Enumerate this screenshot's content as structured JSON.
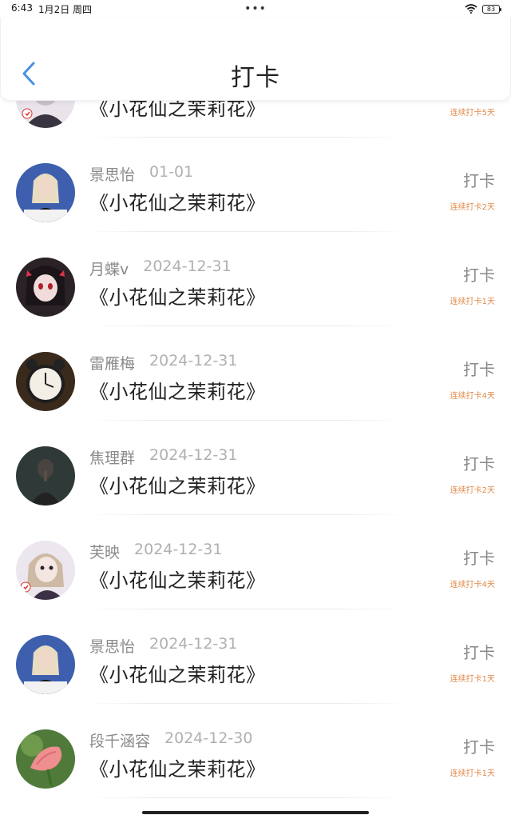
{
  "status_bar": {
    "time": "6:43",
    "date": "1月2日 周四",
    "dots": "•••",
    "battery": "83"
  },
  "header": {
    "title": "打卡"
  },
  "colors": {
    "accent": "#4a90e2",
    "streak": "#e08a4a"
  },
  "records": [
    {
      "name": "",
      "date": "",
      "book": "《小花仙之茉莉花》",
      "action": "",
      "streak": "连续打卡5天",
      "avatar": "anime-avatar"
    },
    {
      "name": "景思怡",
      "date": "01-01",
      "book": "《小花仙之茉莉花》",
      "action": "打卡",
      "streak": "连续打卡2天",
      "avatar": "photo-avatar-girl"
    },
    {
      "name": "月蝶v",
      "date": "2024-12-31",
      "book": "《小花仙之茉莉花》",
      "action": "打卡",
      "streak": "连续打卡1天",
      "avatar": "anime-avatar-dark"
    },
    {
      "name": "雷雁梅",
      "date": "2024-12-31",
      "book": "《小花仙之茉莉花》",
      "action": "打卡",
      "streak": "连续打卡4天",
      "avatar": "alarm-clock-avatar"
    },
    {
      "name": "焦理群",
      "date": "2024-12-31",
      "book": "《小花仙之茉莉花》",
      "action": "打卡",
      "streak": "连续打卡2天",
      "avatar": "dark-photo-avatar"
    },
    {
      "name": "芙映",
      "date": "2024-12-31",
      "book": "《小花仙之茉莉花》",
      "action": "打卡",
      "streak": "连续打卡4天",
      "avatar": "anime-avatar"
    },
    {
      "name": "景思怡",
      "date": "2024-12-31",
      "book": "《小花仙之茉莉花》",
      "action": "打卡",
      "streak": "连续打卡1天",
      "avatar": "photo-avatar-girl"
    },
    {
      "name": "段千涵容",
      "date": "2024-12-30",
      "book": "《小花仙之茉莉花》",
      "action": "打卡",
      "streak": "连续打卡1天",
      "avatar": "flower-avatar"
    }
  ]
}
